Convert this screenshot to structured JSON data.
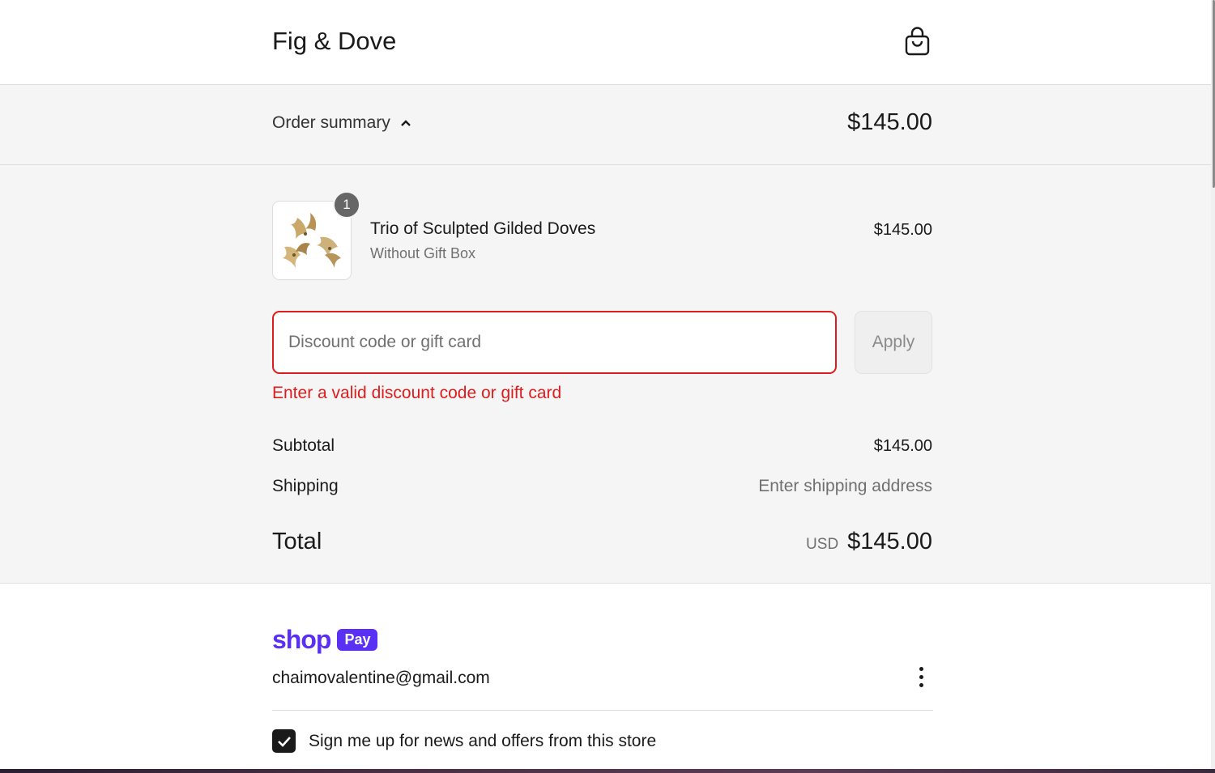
{
  "header": {
    "brand": "Fig & Dove",
    "cart_icon": "shopping-bag-icon"
  },
  "summary_toggle": {
    "label": "Order summary",
    "icon": "chevron-up-icon",
    "total": "$145.00"
  },
  "line_item": {
    "quantity": "1",
    "title": "Trio of Sculpted Gilded Doves",
    "variant": "Without Gift Box",
    "price": "$145.00"
  },
  "discount": {
    "placeholder": "Discount code or gift card",
    "value": "",
    "apply_label": "Apply",
    "error": "Enter a valid discount code or gift card"
  },
  "totals": {
    "subtotal_label": "Subtotal",
    "subtotal_value": "$145.00",
    "shipping_label": "Shipping",
    "shipping_value": "Enter shipping address",
    "total_label": "Total",
    "currency": "USD",
    "total_value": "$145.00"
  },
  "shop_pay": {
    "logo_word": "shop",
    "logo_pill": "Pay",
    "email": "chaimovalentine@gmail.com",
    "menu_icon": "more-vertical-icon"
  },
  "newsletter": {
    "checked": true,
    "label": "Sign me up for news and offers from this store"
  },
  "colors": {
    "error": "#dd1d1d",
    "shop_pay_purple": "#5a31f4",
    "summary_bg": "#f5f5f5"
  }
}
